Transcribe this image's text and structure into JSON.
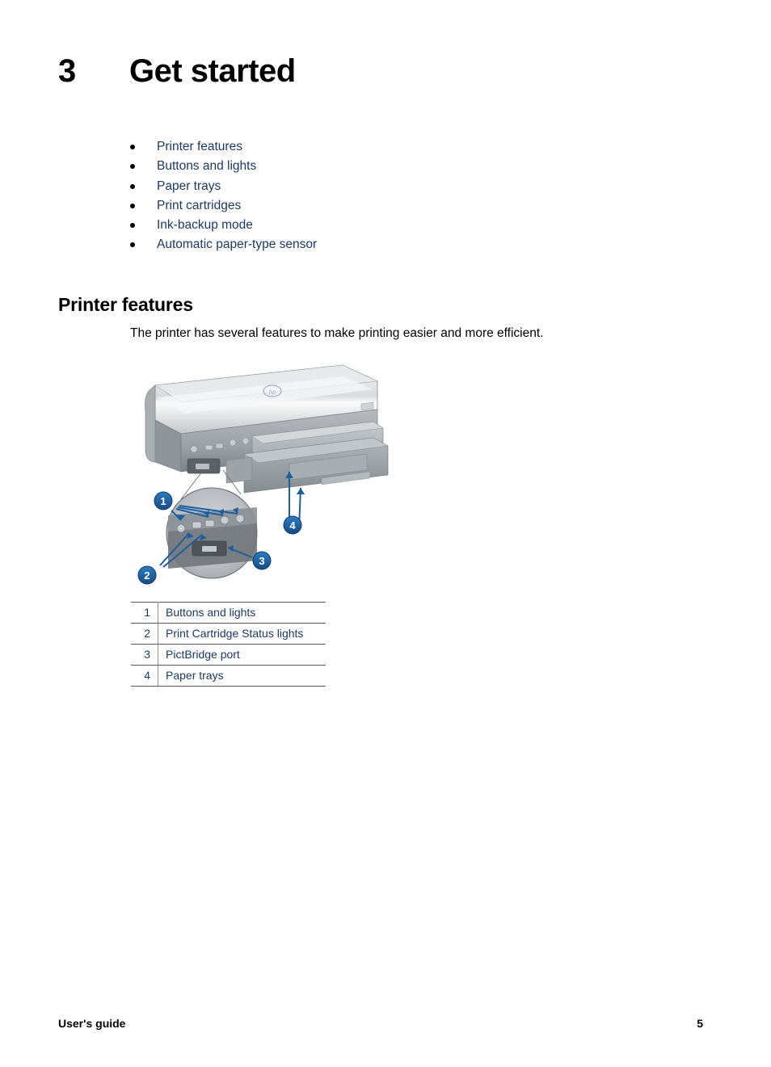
{
  "chapter": {
    "number": "3",
    "title": "Get started"
  },
  "toc": {
    "items": [
      {
        "label": "Printer features"
      },
      {
        "label": "Buttons and lights"
      },
      {
        "label": "Paper trays"
      },
      {
        "label": "Print cartridges"
      },
      {
        "label": "Ink-backup mode"
      },
      {
        "label": "Automatic paper-type sensor"
      }
    ]
  },
  "section": {
    "heading": "Printer features",
    "paragraph": "The printer has several features to make printing easier and more efficient."
  },
  "figure": {
    "alt": "HP Deskjet printer front view with numbered callouts and a magnified detail circle showing the control panel",
    "callouts": [
      {
        "number": "1"
      },
      {
        "number": "2"
      },
      {
        "number": "3"
      },
      {
        "number": "4"
      }
    ]
  },
  "legend": {
    "rows": [
      {
        "number": "1",
        "label": "Buttons and lights"
      },
      {
        "number": "2",
        "label": "Print Cartridge Status lights"
      },
      {
        "number": "3",
        "label": "PictBridge port"
      },
      {
        "number": "4",
        "label": "Paper trays"
      }
    ]
  },
  "footer": {
    "document_title": "User's guide",
    "page_number": "5"
  },
  "colors": {
    "link": "#1a3a68",
    "callout_badge": "#1b5fa0",
    "rule": "#555a5e"
  }
}
